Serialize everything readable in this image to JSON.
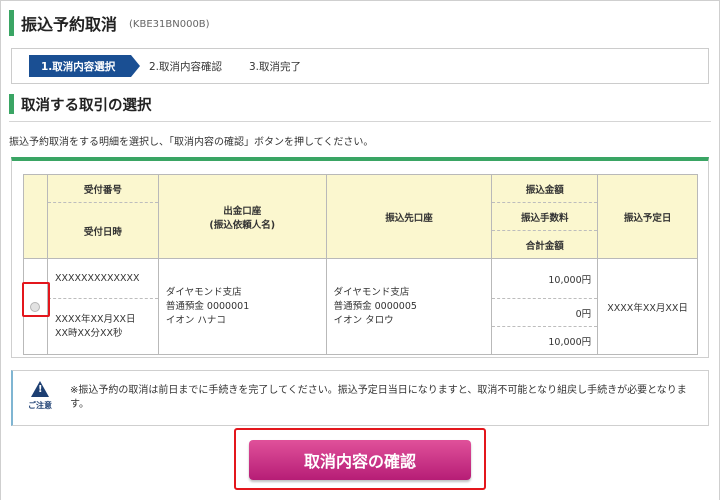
{
  "header": {
    "title": "振込予約取消",
    "screen_code": "(KBE31BN000B)"
  },
  "steps": [
    {
      "label": "1.取消内容選択",
      "active": true
    },
    {
      "label": "2.取消内容確認",
      "active": false
    },
    {
      "label": "3.取消完了",
      "active": false
    }
  ],
  "section": {
    "title": "取消する取引の選択",
    "instruction": "振込予約取消をする明細を選択し、「取消内容の確認」ボタンを押してください。"
  },
  "table": {
    "headers": {
      "receipt_number": "受付番号",
      "receipt_datetime": "受付日時",
      "debit_account_line1": "出金口座",
      "debit_account_line2": "(振込依頼人名)",
      "credit_account": "振込先口座",
      "transfer_amount": "振込金額",
      "transfer_fee": "振込手数料",
      "total_amount": "合計金額",
      "scheduled_date": "振込予定日"
    },
    "rows": [
      {
        "receipt_number": "XXXXXXXXXXXXX",
        "receipt_date": "XXXX年XX月XX日",
        "receipt_time": "XX時XX分XX秒",
        "debit_branch": "ダイヤモンド支店",
        "debit_account": "普通預金 0000001",
        "debit_name": "イオン ハナコ",
        "credit_branch": "ダイヤモンド支店",
        "credit_account": "普通預金 0000005",
        "credit_name": "イオン タロウ",
        "transfer_amount": "10,000円",
        "transfer_fee": "0円",
        "total_amount": "10,000円",
        "scheduled_date": "XXXX年XX月XX日"
      }
    ]
  },
  "notice": {
    "label": "ご注意",
    "text": "※振込予約の取消は前日までに手続きを完了してください。振込予定日当日になりますと、取消不可能となり組戻し手続きが必要となります。"
  },
  "buttons": {
    "confirm": "取消内容の確認"
  },
  "colors": {
    "accent_green": "#3aa564",
    "step_active": "#1a4f93",
    "header_cell": "#fbf7cf",
    "button_magenta": "#c8307f",
    "highlight_red": "#e3161c"
  }
}
